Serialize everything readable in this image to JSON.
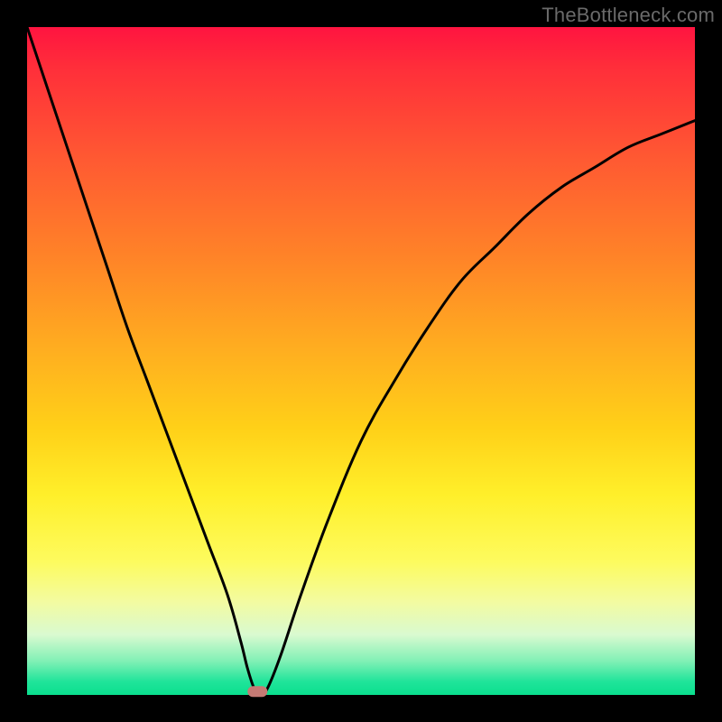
{
  "watermark": {
    "text": "TheBottleneck.com"
  },
  "chart_data": {
    "type": "line",
    "title": "",
    "xlabel": "",
    "ylabel": "",
    "xlim": [
      0,
      100
    ],
    "ylim": [
      0,
      100
    ],
    "background": "red-to-green vertical gradient",
    "series": [
      {
        "name": "bottleneck-curve",
        "x": [
          0,
          3,
          6,
          9,
          12,
          15,
          18,
          21,
          24,
          27,
          30,
          32,
          33,
          34,
          35,
          36,
          38,
          41,
          45,
          50,
          55,
          60,
          65,
          70,
          75,
          80,
          85,
          90,
          95,
          100
        ],
        "y": [
          100,
          91,
          82,
          73,
          64,
          55,
          47,
          39,
          31,
          23,
          15,
          8,
          4,
          1,
          0,
          1,
          6,
          15,
          26,
          38,
          47,
          55,
          62,
          67,
          72,
          76,
          79,
          82,
          84,
          86
        ]
      }
    ],
    "markers": [
      {
        "name": "optimal-point",
        "x": 34.5,
        "y": 0.5,
        "color": "#c57a74",
        "shape": "rounded-rect"
      }
    ]
  }
}
